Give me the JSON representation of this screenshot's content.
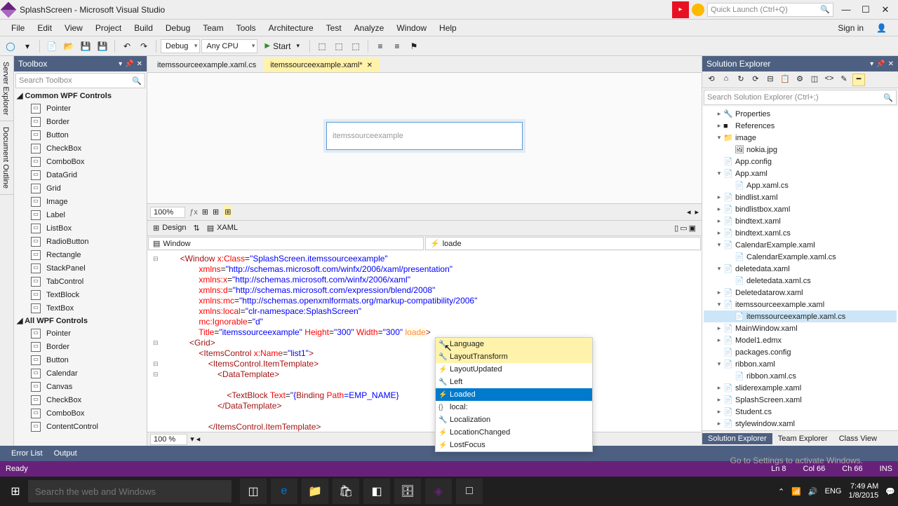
{
  "title": "SplashScreen - Microsoft Visual Studio",
  "quickLaunch": "Quick Launch (Ctrl+Q)",
  "signIn": "Sign in",
  "menu": [
    "File",
    "Edit",
    "View",
    "Project",
    "Build",
    "Debug",
    "Team",
    "Tools",
    "Architecture",
    "Test",
    "Analyze",
    "Window",
    "Help"
  ],
  "configs": {
    "debug": "Debug",
    "platform": "Any CPU",
    "start": "Start"
  },
  "sideTabs": [
    "Server Explorer",
    "Document Outline"
  ],
  "toolbox": {
    "title": "Toolbox",
    "search": "Search Toolbox",
    "group1": "Common WPF Controls",
    "group2": "All WPF Controls",
    "items1": [
      "Pointer",
      "Border",
      "Button",
      "CheckBox",
      "ComboBox",
      "DataGrid",
      "Grid",
      "Image",
      "Label",
      "ListBox",
      "RadioButton",
      "Rectangle",
      "StackPanel",
      "TabControl",
      "TextBlock",
      "TextBox"
    ],
    "items2": [
      "Pointer",
      "Border",
      "Button",
      "Calendar",
      "Canvas",
      "CheckBox",
      "ComboBox",
      "ContentControl"
    ]
  },
  "tabs": [
    {
      "label": "itemssourceexample.xaml.cs",
      "active": false
    },
    {
      "label": "itemssourceexample.xaml*",
      "active": true
    }
  ],
  "designer": {
    "windowTitle": "itemssourceexample",
    "zoom": "100%",
    "zoom2": "100 %"
  },
  "splitLabels": {
    "design": "Design",
    "xaml": "XAML"
  },
  "nav": {
    "left": "Window",
    "right": "loade"
  },
  "code": {
    "l1a": "<Window ",
    "l1b": "x:Class",
    "l1c": "=",
    "l1d": "\"SplashScreen.itemssourceexample\"",
    "l2a": "xmlns",
    "l2b": "=",
    "l2c": "\"http://schemas.microsoft.com/winfx/2006/xaml/presentation\"",
    "l3a": "xmlns:x",
    "l3c": "\"http://schemas.microsoft.com/winfx/2006/xaml\"",
    "l4a": "xmlns:d",
    "l4c": "\"http://schemas.microsoft.com/expression/blend/2008\"",
    "l5a": "xmlns:mc",
    "l5c": "\"http://schemas.openxmlformats.org/markup-compatibility/2006\"",
    "l6a": "xmlns:local",
    "l6c": "\"clr-namespace:SplashScreen\"",
    "l7a": "mc:Ignorable",
    "l7c": "\"d\"",
    "l8a": "Title",
    "l8c": "\"itemssourceexample\"",
    "l8d": "Height",
    "l8e": "\"300\"",
    "l8f": "Width",
    "l8g": "\"300\"",
    "l8h": "loade",
    "l8i": ">",
    "l9": "<Grid>",
    "l10a": "<ItemsControl ",
    "l10b": "x:Name",
    "l10c": "\"list1\"",
    "l10d": ">",
    "l11": "<ItemsControl.ItemTemplate>",
    "l12": "<DataTemplate>",
    "l13a": "<TextBlock ",
    "l13b": "Text",
    "l13c": "=",
    "l13d": "\"{",
    "l13e": "Binding ",
    "l13f": "Path",
    "l13g": "=EMP_NAME}",
    "l14": "</DataTemplate>",
    "l15": "</ItemsControl.ItemTemplate>"
  },
  "intellisense": [
    {
      "label": "Language",
      "icon": "🔧"
    },
    {
      "label": "LayoutTransform",
      "icon": "🔧"
    },
    {
      "label": "LayoutUpdated",
      "icon": "⚡"
    },
    {
      "label": "Left",
      "icon": "🔧"
    },
    {
      "label": "Loaded",
      "icon": "⚡",
      "sel": true
    },
    {
      "label": "local:",
      "icon": "{}"
    },
    {
      "label": "Localization",
      "icon": "🔧"
    },
    {
      "label": "LocationChanged",
      "icon": "⚡"
    },
    {
      "label": "LostFocus",
      "icon": "⚡"
    }
  ],
  "solExp": {
    "title": "Solution Explorer",
    "search": "Search Solution Explorer (Ctrl+;)",
    "tree": [
      {
        "l": 1,
        "e": "▸",
        "i": "🔧",
        "t": "Properties"
      },
      {
        "l": 1,
        "e": "▸",
        "i": "■",
        "t": "References"
      },
      {
        "l": 1,
        "e": "▾",
        "i": "📁",
        "t": "image"
      },
      {
        "l": 2,
        "e": "",
        "i": "🖼",
        "t": "nokia.jpg"
      },
      {
        "l": 1,
        "e": "",
        "i": "📄",
        "t": "App.config"
      },
      {
        "l": 1,
        "e": "▾",
        "i": "📄",
        "t": "App.xaml"
      },
      {
        "l": 2,
        "e": "",
        "i": "📄",
        "t": "App.xaml.cs"
      },
      {
        "l": 1,
        "e": "▸",
        "i": "📄",
        "t": "bindlist.xaml"
      },
      {
        "l": 1,
        "e": "▸",
        "i": "📄",
        "t": "bindlistbox.xaml"
      },
      {
        "l": 1,
        "e": "▸",
        "i": "📄",
        "t": "bindtext.xaml"
      },
      {
        "l": 1,
        "e": "▸",
        "i": "📄",
        "t": "bindtext.xaml.cs"
      },
      {
        "l": 1,
        "e": "▾",
        "i": "📄",
        "t": "CalendarExample.xaml"
      },
      {
        "l": 2,
        "e": "",
        "i": "📄",
        "t": "CalendarExample.xaml.cs"
      },
      {
        "l": 1,
        "e": "▾",
        "i": "📄",
        "t": "deletedata.xaml"
      },
      {
        "l": 2,
        "e": "",
        "i": "📄",
        "t": "deletedata.xaml.cs"
      },
      {
        "l": 1,
        "e": "▸",
        "i": "📄",
        "t": "Deletedatarow.xaml"
      },
      {
        "l": 1,
        "e": "▾",
        "i": "📄",
        "t": "itemssourceexample.xaml"
      },
      {
        "l": 2,
        "e": "",
        "i": "📄",
        "t": "itemssourceexample.xaml.cs",
        "sel": true
      },
      {
        "l": 1,
        "e": "▸",
        "i": "📄",
        "t": "MainWindow.xaml"
      },
      {
        "l": 1,
        "e": "▸",
        "i": "📄",
        "t": "Model1.edmx"
      },
      {
        "l": 1,
        "e": "",
        "i": "📄",
        "t": "packages.config"
      },
      {
        "l": 1,
        "e": "▾",
        "i": "📄",
        "t": "ribbon.xaml"
      },
      {
        "l": 2,
        "e": "",
        "i": "📄",
        "t": "ribbon.xaml.cs"
      },
      {
        "l": 1,
        "e": "▸",
        "i": "📄",
        "t": "sliderexample.xaml"
      },
      {
        "l": 1,
        "e": "▸",
        "i": "📄",
        "t": "SplashScreen.xaml"
      },
      {
        "l": 1,
        "e": "▸",
        "i": "📄",
        "t": "Student.cs"
      },
      {
        "l": 1,
        "e": "▸",
        "i": "📄",
        "t": "stylewindow.xaml"
      }
    ],
    "tabs": [
      "Solution Explorer",
      "Team Explorer",
      "Class View"
    ]
  },
  "bottomTabs": [
    "Error List",
    "Output"
  ],
  "watermark": "Go to Settings to activate Windows.",
  "status": {
    "ready": "Ready",
    "ln": "Ln 8",
    "col": "Col 66",
    "ch": "Ch 66",
    "ins": "INS"
  },
  "taskbar": {
    "search": "Search the web and Windows",
    "time": "7:49 AM",
    "date": "1/8/2015",
    "lang": "ENG"
  }
}
